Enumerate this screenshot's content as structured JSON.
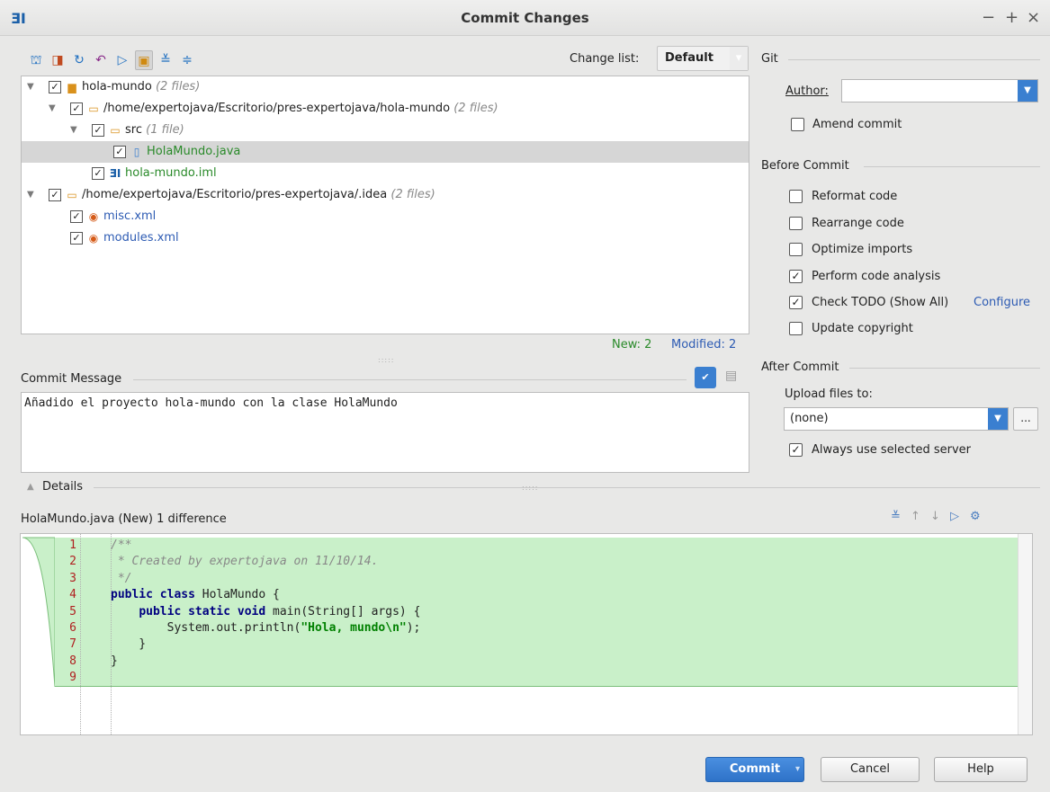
{
  "window": {
    "app_icon": "intellij-logo-icon",
    "title": "Commit Changes",
    "controls": [
      "−",
      "+",
      "×"
    ]
  },
  "toolbar": {
    "icons": [
      "commit-diff-icon",
      "move-icon",
      "refresh-icon",
      "revert-icon",
      "show-diff-icon",
      "group-by-directory-icon",
      "expand-all-icon",
      "collapse-all-icon"
    ],
    "changelist_label": "Change list:",
    "changelist_value": "Default"
  },
  "tree": {
    "rows": [
      {
        "name": "hola-mundo",
        "hint": "(2 files)"
      },
      {
        "name": "/home/expertojava/Escritorio/pres-expertojava/hola-mundo",
        "hint": "(2 files)"
      },
      {
        "name": "src",
        "hint": "(1 file)"
      },
      {
        "name": "HolaMundo.java",
        "hint": ""
      },
      {
        "name": "hola-mundo.iml",
        "hint": ""
      },
      {
        "name": "/home/expertojava/Escritorio/pres-expertojava/.idea",
        "hint": "(2 files)"
      },
      {
        "name": "misc.xml",
        "hint": ""
      },
      {
        "name": "modules.xml",
        "hint": ""
      }
    ],
    "status_new": "New: 2",
    "status_modified": "Modified: 2"
  },
  "commit_message": {
    "label": "Commit Message",
    "value": "Añadido el proyecto hola-mundo con la clase HolaMundo"
  },
  "git": {
    "section": "Git",
    "author_label": "Author:",
    "author_value": "",
    "amend_label": "Amend commit"
  },
  "before_commit": {
    "section": "Before Commit",
    "options": [
      {
        "label": "Reformat code",
        "checked": false
      },
      {
        "label": "Rearrange code",
        "checked": false
      },
      {
        "label": "Optimize imports",
        "checked": false
      },
      {
        "label": "Perform code analysis",
        "checked": true
      },
      {
        "label": "Check TODO (Show All)",
        "checked": true
      },
      {
        "label": "Update copyright",
        "checked": false
      }
    ],
    "configure_link": "Configure"
  },
  "after_commit": {
    "section": "After Commit",
    "upload_label": "Upload files to:",
    "upload_value": "(none)",
    "ellipsis": "...",
    "always_use_label": "Always use selected server"
  },
  "details": {
    "label": "Details",
    "diff_title": "HolaMundo.java (New) 1 difference",
    "code_lines": [
      "/**",
      " * Created by expertojava on 11/10/14.",
      " */",
      "public class HolaMundo {",
      "    public static void main(String[] args) {",
      "        System.out.println(\"Hola, mundo\\n\");",
      "    }",
      "}",
      ""
    ],
    "line_numbers": [
      "1",
      "2",
      "3",
      "4",
      "5",
      "6",
      "7",
      "8",
      "9"
    ]
  },
  "buttons": {
    "commit": "Commit",
    "cancel": "Cancel",
    "help": "Help"
  }
}
